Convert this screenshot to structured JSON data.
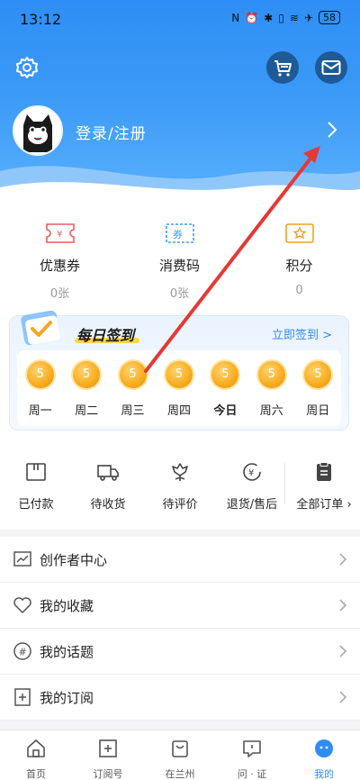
{
  "status": {
    "time": "13:12",
    "battery": "58"
  },
  "profile": {
    "login_label": "登录/注册"
  },
  "wallet": [
    {
      "label": "优惠券",
      "value": "0张",
      "icon": "coupon-icon"
    },
    {
      "label": "消费码",
      "value": "0张",
      "icon": "voucher-icon"
    },
    {
      "label": "积分",
      "value": "0",
      "icon": "points-icon"
    }
  ],
  "checkin": {
    "title": "每日签到",
    "link": "立即签到 >",
    "days": [
      {
        "label": "周一",
        "coin": "5"
      },
      {
        "label": "周二",
        "coin": "5"
      },
      {
        "label": "周三",
        "coin": "5"
      },
      {
        "label": "周四",
        "coin": "5"
      },
      {
        "label": "今日",
        "coin": "5"
      },
      {
        "label": "周六",
        "coin": "5"
      },
      {
        "label": "周日",
        "coin": "5"
      }
    ]
  },
  "orders": [
    {
      "label": "已付款",
      "icon": "paid-icon"
    },
    {
      "label": "待收货",
      "icon": "truck-icon"
    },
    {
      "label": "待评价",
      "icon": "review-icon"
    },
    {
      "label": "退货/售后",
      "icon": "refund-icon"
    },
    {
      "label": "全部订单",
      "icon": "clipboard-icon"
    }
  ],
  "menu": [
    {
      "label": "创作者中心",
      "icon": "chart-icon"
    },
    {
      "label": "我的收藏",
      "icon": "heart-icon"
    },
    {
      "label": "我的话题",
      "icon": "hashtag-icon"
    },
    {
      "label": "我的订阅",
      "icon": "subscribe-icon"
    }
  ],
  "tabs": [
    {
      "label": "首页",
      "icon": "home-icon",
      "active": false
    },
    {
      "label": "订阅号",
      "icon": "plus-box-icon",
      "active": false
    },
    {
      "label": "在兰州",
      "icon": "bag-icon",
      "active": false
    },
    {
      "label": "问 · 证",
      "icon": "chat-icon",
      "active": false
    },
    {
      "label": "我的",
      "icon": "profile-face-icon",
      "active": true
    }
  ],
  "colors": {
    "accent": "#2f8cf2",
    "header": "#3b9af7",
    "coin": "#f7ab1d",
    "annotation": "#e53935"
  }
}
